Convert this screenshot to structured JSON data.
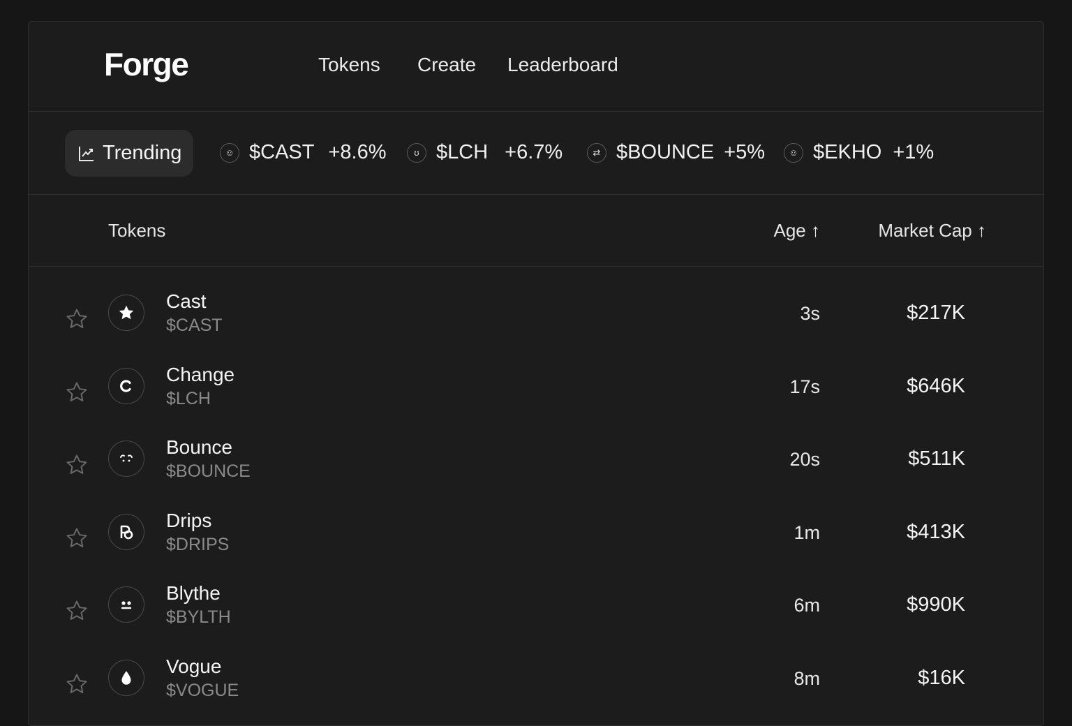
{
  "app": {
    "logo": "Forge"
  },
  "nav": {
    "items": [
      {
        "label": "Tokens"
      },
      {
        "label": "Create"
      },
      {
        "label": "Leaderboard"
      }
    ]
  },
  "trending": {
    "label": "Trending",
    "icon": "trending-chart-icon",
    "items": [
      {
        "symbol": "$CAST",
        "change": "+8.6%"
      },
      {
        "symbol": "$LCH",
        "change": "+6.7%"
      },
      {
        "symbol": "$BOUNCE",
        "change": "+5%"
      },
      {
        "symbol": "$EKHO",
        "change": "+1%"
      }
    ]
  },
  "table": {
    "columns": {
      "tokens": "Tokens",
      "age": "Age ↑",
      "market_cap": "Market Cap ↑"
    },
    "rows": [
      {
        "name": "Cast",
        "symbol": "$CAST",
        "age": "3s",
        "market_cap": "$217K",
        "icon": "star-icon"
      },
      {
        "name": "Change",
        "symbol": "$LCH",
        "age": "17s",
        "market_cap": "$646K",
        "icon": "c-letter-icon"
      },
      {
        "name": "Bounce",
        "symbol": "$BOUNCE",
        "age": "20s",
        "market_cap": "$511K",
        "icon": "bounce-face-icon"
      },
      {
        "name": "Drips",
        "symbol": "$DRIPS",
        "age": "1m",
        "market_cap": "$413K",
        "icon": "drips-logo-icon"
      },
      {
        "name": "Blythe",
        "symbol": "$BYLTH",
        "age": "6m",
        "market_cap": "$990K",
        "icon": "robot-face-icon"
      },
      {
        "name": "Vogue",
        "symbol": "$VOGUE",
        "age": "8m",
        "market_cap": "$16K",
        "icon": "droplet-icon"
      }
    ]
  },
  "colors": {
    "background": "#161616",
    "panel": "#1c1c1c",
    "divider": "#303030",
    "pill": "#2c2c2c",
    "muted_text": "#8a8a8a"
  }
}
